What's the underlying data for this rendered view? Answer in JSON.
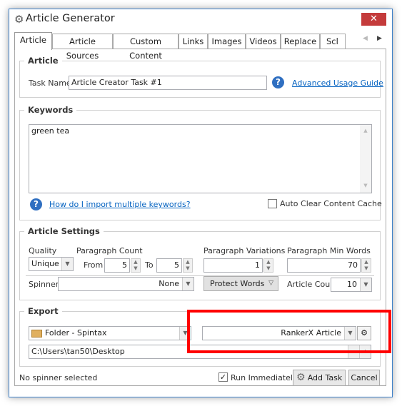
{
  "window": {
    "title": "Article Generator",
    "close_icon": "close-icon",
    "app_icon": "gear-icon"
  },
  "tabs": [
    {
      "label": "Article"
    },
    {
      "label": "Article Sources"
    },
    {
      "label": "Custom Content"
    },
    {
      "label": "Links"
    },
    {
      "label": "Images"
    },
    {
      "label": "Videos"
    },
    {
      "label": "Replace"
    },
    {
      "label": "Scl"
    }
  ],
  "article": {
    "group_title": "Article",
    "task_name_label": "Task Name",
    "task_name_value": "Article Creator Task #1",
    "help": "?",
    "guide_link": "Advanced Usage Guide"
  },
  "keywords": {
    "group_title": "Keywords",
    "value": "green tea",
    "help": "?",
    "import_link": "How do I import multiple keywords?",
    "auto_clear_label": "Auto Clear Content Cache",
    "auto_clear_checked": false
  },
  "settings": {
    "group_title": "Article Settings",
    "quality_label": "Quality",
    "quality_value": "Unique",
    "paragraph_count_label": "Paragraph Count",
    "from_label": "From",
    "from_value": "5",
    "to_label": "To",
    "to_value": "5",
    "variations_label": "Paragraph Variations",
    "variations_value": "1",
    "min_words_label": "Paragraph Min Words",
    "min_words_value": "70",
    "spinner_label": "Spinner",
    "spinner_value": "None",
    "protect_words_label": "Protect Words",
    "article_count_label": "Article Count",
    "article_count_value": "10"
  },
  "export": {
    "group_title": "Export",
    "format_value": "Folder - Spintax",
    "template_value": "RankerX Article",
    "path_value": "C:\\Users\\tan50\\Desktop",
    "browse_label": "...",
    "highlight_color": "#ff0000"
  },
  "footer": {
    "status": "No spinner selected",
    "run_immediately_label": "Run Immediately",
    "run_immediately_checked": true,
    "add_task_label": "Add Task",
    "cancel_label": "Cancel"
  }
}
